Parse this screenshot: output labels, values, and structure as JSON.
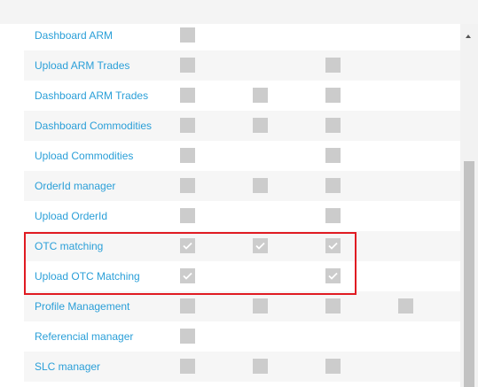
{
  "colors": {
    "link": "#2a9fd8",
    "checkbox": "#cccccc",
    "check": "#ffffff",
    "highlight": "#e01b22",
    "row_shade": "#f6f6f6"
  },
  "icons": {
    "checkmark": "check-icon",
    "scroll_up": "chevron-up-icon"
  },
  "permissions": [
    {
      "label": "Dashboard ARM",
      "checkboxes": [
        {
          "checked": false
        }
      ]
    },
    {
      "label": "Upload ARM Trades",
      "checkboxes": [
        {
          "checked": false
        },
        null,
        {
          "checked": false
        }
      ]
    },
    {
      "label": "Dashboard ARM Trades",
      "checkboxes": [
        {
          "checked": false
        },
        {
          "checked": false
        },
        {
          "checked": false
        }
      ]
    },
    {
      "label": "Dashboard Commodities",
      "checkboxes": [
        {
          "checked": false
        },
        {
          "checked": false
        },
        {
          "checked": false
        }
      ]
    },
    {
      "label": "Upload Commodities",
      "checkboxes": [
        {
          "checked": false
        },
        null,
        {
          "checked": false
        }
      ]
    },
    {
      "label": "OrderId manager",
      "checkboxes": [
        {
          "checked": false
        },
        {
          "checked": false
        },
        {
          "checked": false
        }
      ]
    },
    {
      "label": "Upload OrderId",
      "checkboxes": [
        {
          "checked": false
        },
        null,
        {
          "checked": false
        }
      ]
    },
    {
      "label": "OTC matching",
      "checkboxes": [
        {
          "checked": true
        },
        {
          "checked": true
        },
        {
          "checked": true
        }
      ]
    },
    {
      "label": "Upload OTC Matching",
      "checkboxes": [
        {
          "checked": true
        },
        null,
        {
          "checked": true
        }
      ]
    },
    {
      "label": "Profile Management",
      "checkboxes": [
        {
          "checked": false
        },
        {
          "checked": false
        },
        {
          "checked": false
        },
        {
          "checked": false
        }
      ]
    },
    {
      "label": "Referencial manager",
      "checkboxes": [
        {
          "checked": false
        }
      ]
    },
    {
      "label": "SLC manager",
      "checkboxes": [
        {
          "checked": false
        },
        {
          "checked": false
        },
        {
          "checked": false
        }
      ]
    }
  ]
}
